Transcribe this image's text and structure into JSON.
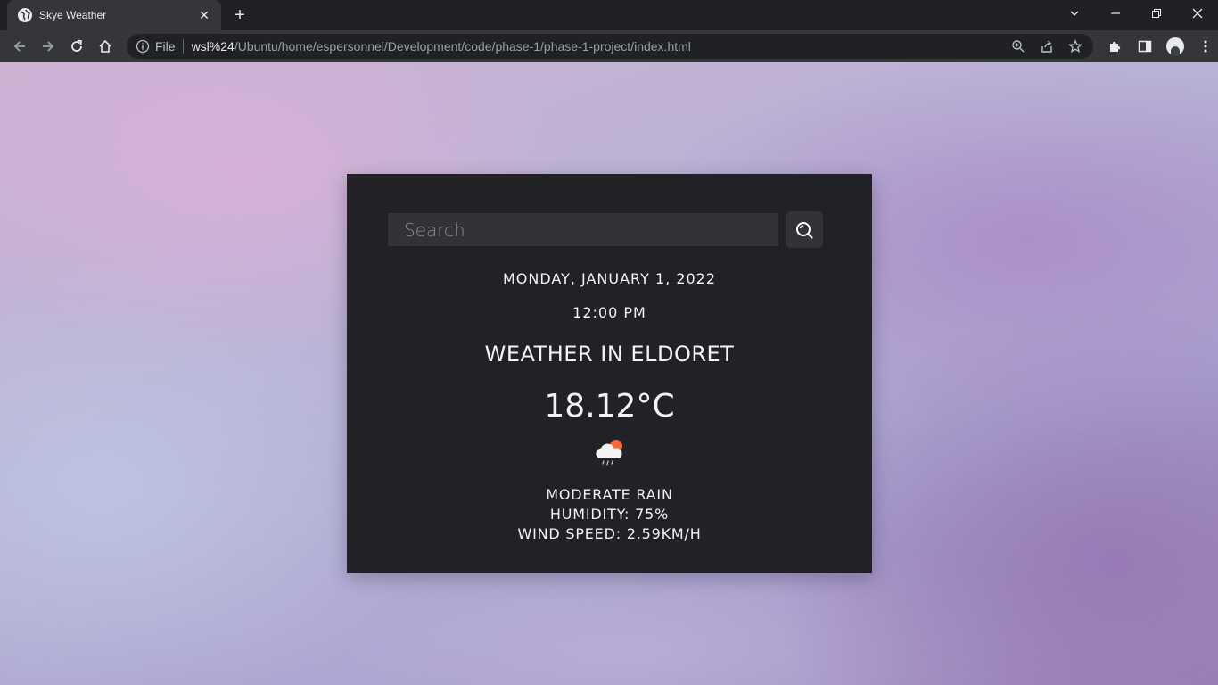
{
  "browser": {
    "tab_title": "Skye Weather",
    "tab_close": "✕",
    "new_tab": "+",
    "file_label": "File",
    "url_host": "wsl%24",
    "url_path": "/Ubuntu/home/espersonnel/Development/code/phase-1/phase-1-project/index.html"
  },
  "icons": {
    "tab_favicon": "globe-icon",
    "back": "back-arrow-icon",
    "forward": "forward-arrow-icon",
    "reload": "reload-icon",
    "home": "home-icon",
    "site_info": "info-icon",
    "zoom": "zoom-icon",
    "share": "share-icon",
    "bookmark": "star-icon",
    "extensions": "puzzle-icon",
    "side_panel": "side-panel-icon",
    "menu": "kebab-menu-icon",
    "search": "search-icon",
    "weather": "rain-cloud-icon"
  },
  "weather": {
    "search_placeholder": "Search",
    "date": "MONDAY, JANUARY 1, 2022",
    "time": "12:00 PM",
    "city_heading": "WEATHER IN ELDORET",
    "temperature": "18.12°C",
    "description": "MODERATE RAIN",
    "humidity": "HUMIDITY: 75%",
    "wind_speed": "WIND SPEED: 2.59KM/H"
  },
  "colors": {
    "card_bg": "#222125",
    "input_bg": "#333236",
    "chrome_dark": "#202124",
    "chrome_toolbar": "#35363a"
  }
}
